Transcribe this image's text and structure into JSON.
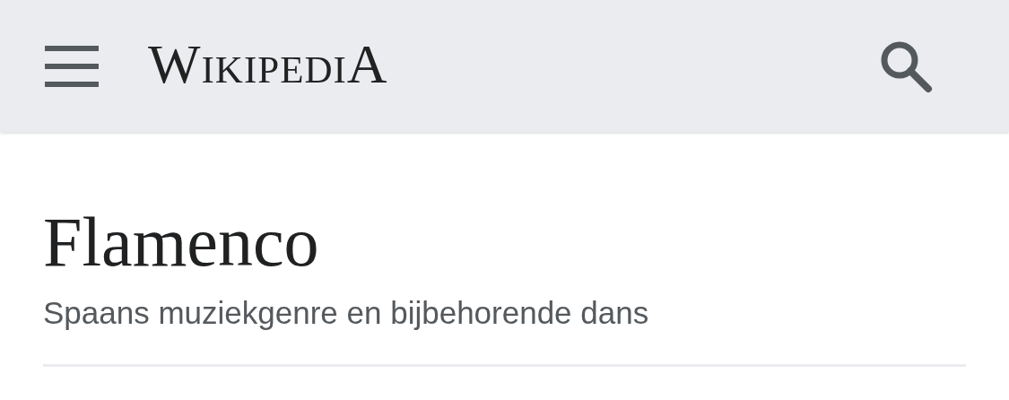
{
  "header": {
    "logo": "WikipediA"
  },
  "article": {
    "title": "Flamenco",
    "description": "Spaans muziekgenre en bijbehorende dans"
  }
}
